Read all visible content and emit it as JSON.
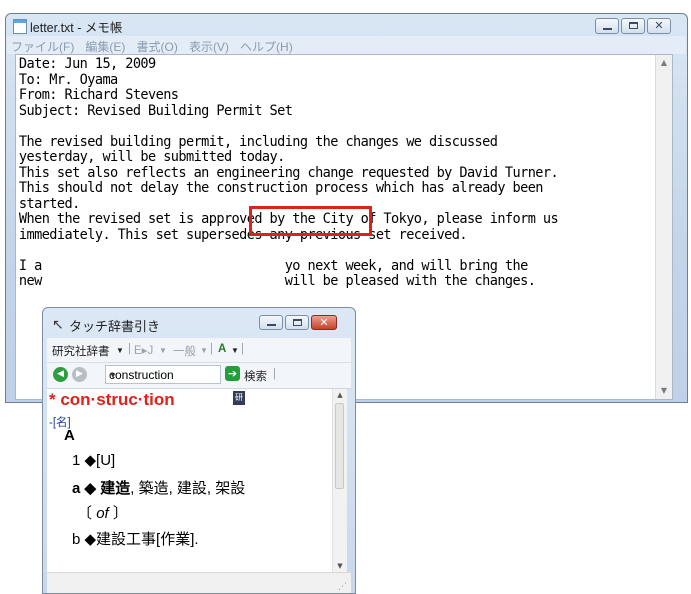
{
  "notepad": {
    "title": "letter.txt - メモ帳",
    "menu": [
      "ファイル(F)",
      "編集(E)",
      "書式(O)",
      "表示(V)",
      "ヘルプ(H)"
    ],
    "lines": [
      "Date: Jun 15, 2009",
      "To: Mr. Oyama",
      "From: Richard Stevens",
      "Subject: Revised Building Permit Set",
      "",
      "The revised building permit, including the changes we discussed",
      "yesterday, will be submitted today.",
      "This set also reflects an engineering change requested by David Turner.",
      "This should not delay the construction process which has already been",
      "started.",
      "When the revised set is approved by the City of Tokyo, please inform us",
      "immediately. This set supersedes any previous set received.",
      "",
      "I a                                yo next week, and will bring the",
      "new                                will be pleased with the changes."
    ],
    "highlighted_word": "construction"
  },
  "dictionary": {
    "title": "タッチ辞書引き",
    "toolbar": {
      "dictionary_name": "研究社辞書",
      "direction": "E▸J",
      "scope": "一般",
      "search_value": "construction",
      "search_label": "検索"
    },
    "entry": {
      "headword": "* con·struc·tion",
      "pos": "-[名]",
      "sense_group": "A",
      "sense1": "1 ◆[U]",
      "sub_a_label": "a ◆",
      "sub_a_main": "建造",
      "sub_a_rest": ", 築造, 建設, 架設",
      "sub_a_prep_open": "〔",
      "sub_a_prep": "of",
      "sub_a_prep_close": "〕",
      "sub_b": "b ◆建設工事[作業]."
    },
    "colors": {
      "headword": "#e0211b",
      "highlight_box": "#e0211b"
    }
  }
}
